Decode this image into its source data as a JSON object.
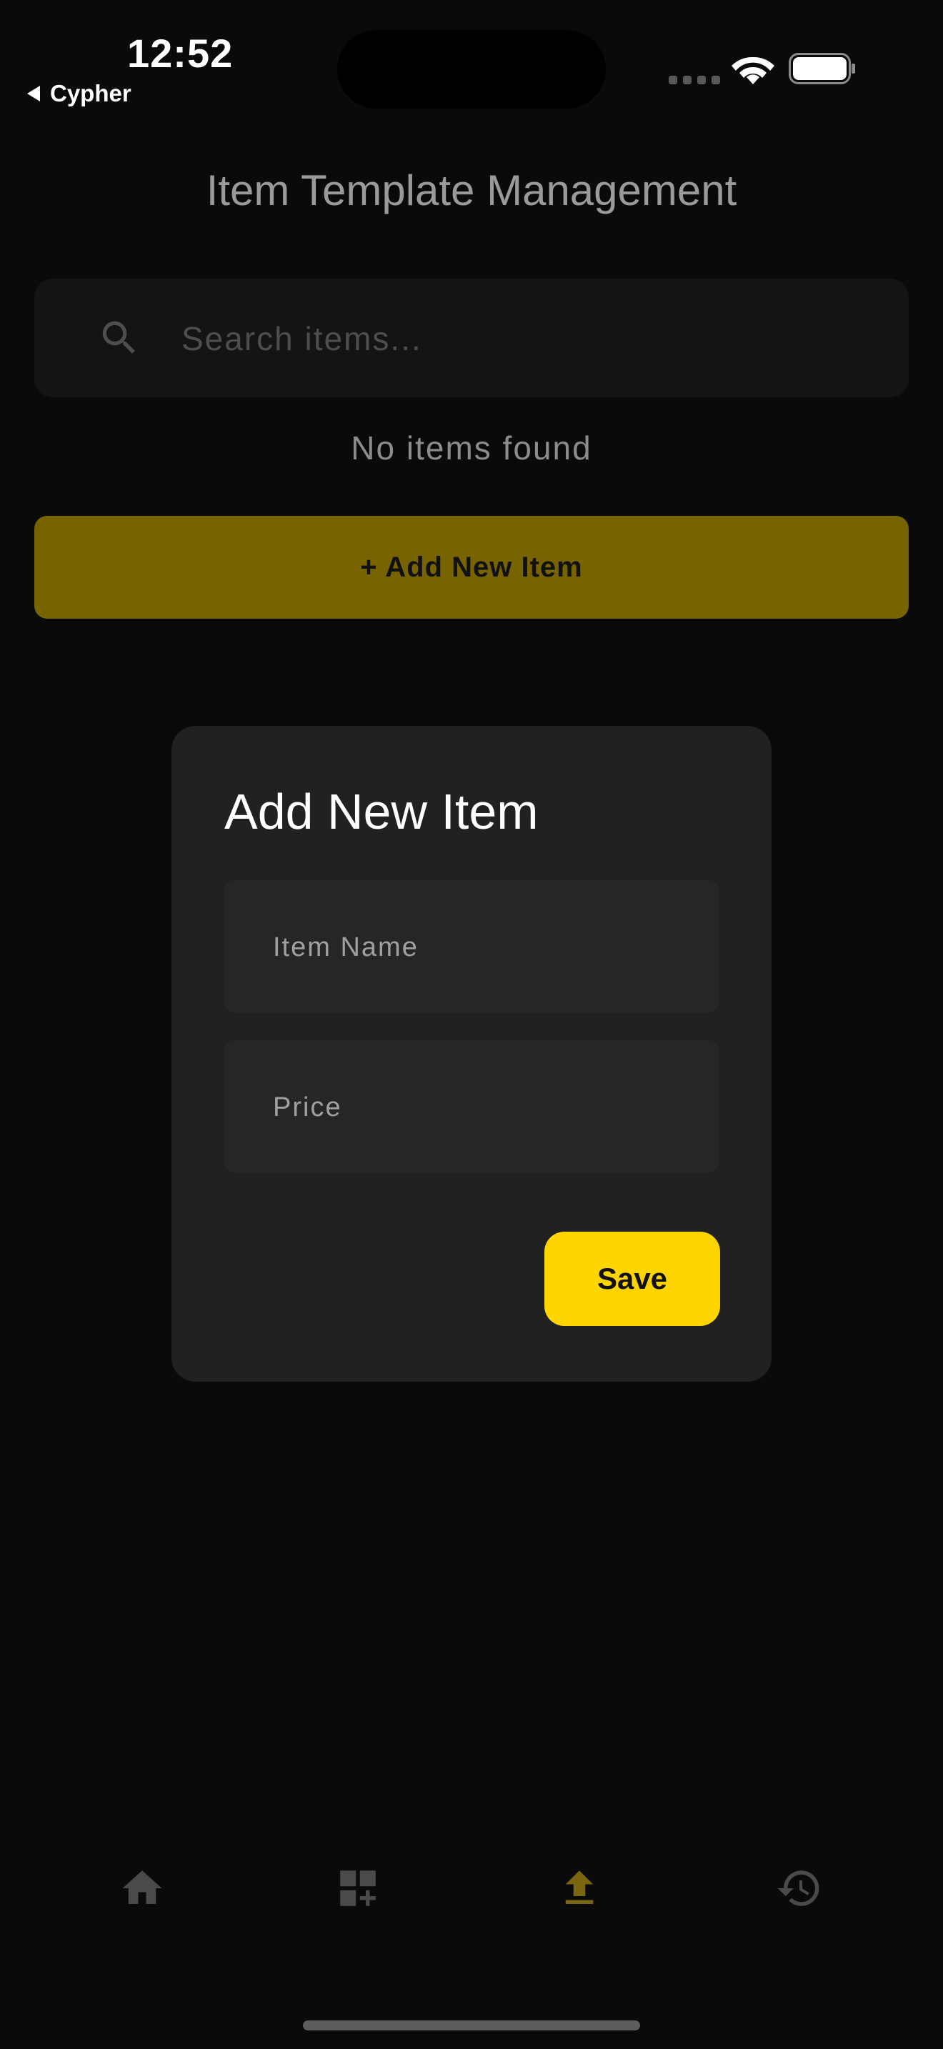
{
  "status_bar": {
    "time": "12:52",
    "back_label": "Cypher"
  },
  "header": {
    "title": "Item Template Management"
  },
  "search": {
    "placeholder": "Search items...",
    "value": ""
  },
  "list": {
    "empty_text": "No items found"
  },
  "add_button": {
    "label": "+ Add New Item"
  },
  "dialog": {
    "title": "Add New Item",
    "name_placeholder": "Item Name",
    "price_placeholder": "Price",
    "save_label": "Save"
  },
  "bottom_nav": {
    "items": [
      {
        "icon": "home-icon",
        "active": false
      },
      {
        "icon": "dashboard-add-icon",
        "active": false
      },
      {
        "icon": "upload-icon",
        "active": true
      },
      {
        "icon": "history-icon",
        "active": false
      }
    ]
  },
  "colors": {
    "background": "#0a0a0a",
    "accent": "#ffd500",
    "accent_dimmed": "#776300",
    "dialog_bg": "#212121",
    "inactive_icon": "#4a4a4a"
  }
}
